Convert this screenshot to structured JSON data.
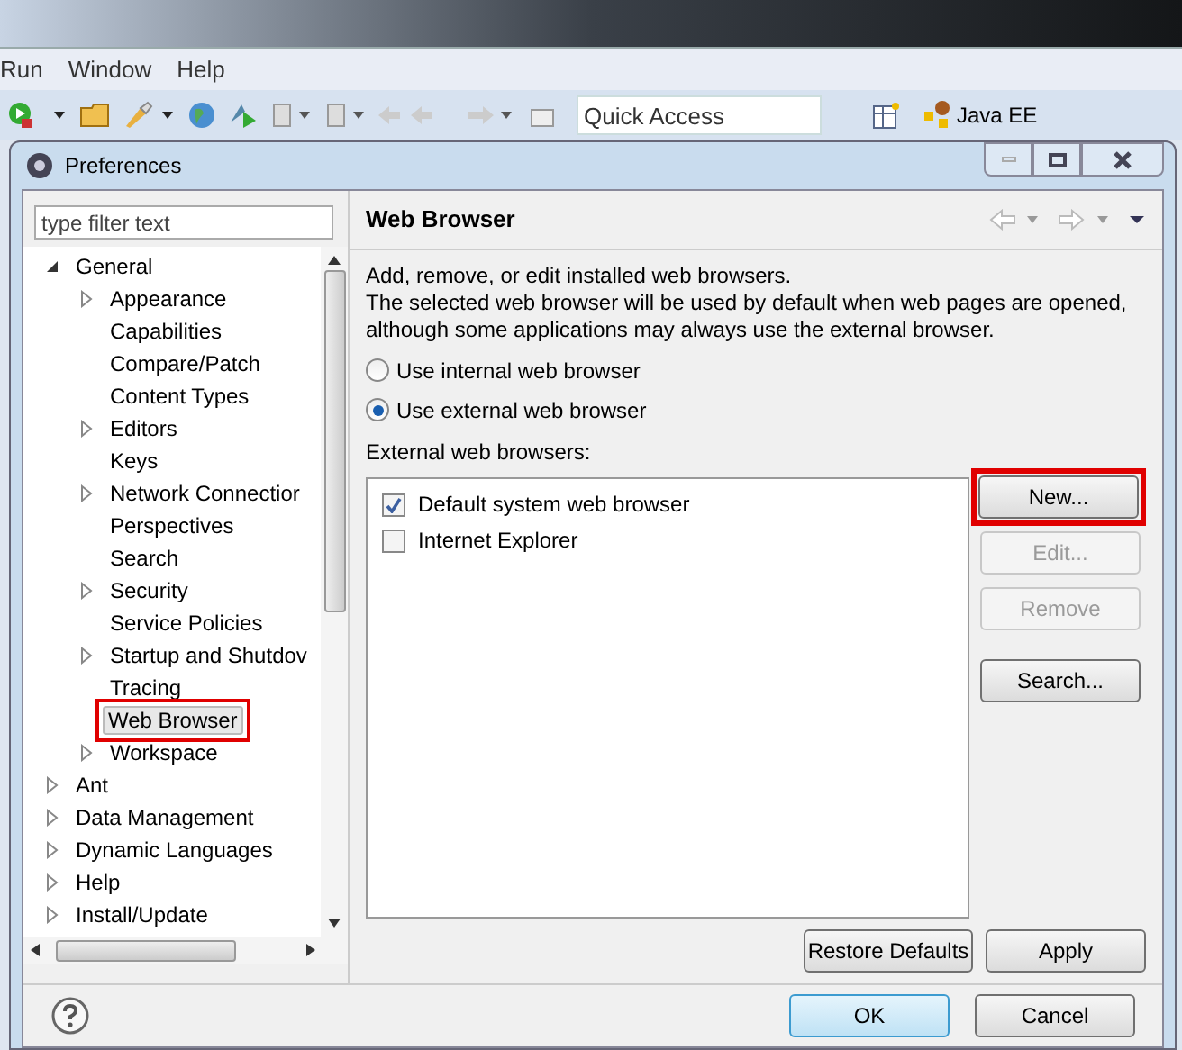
{
  "menu_bar": [
    "Run",
    "Window",
    "Help"
  ],
  "toolbar": {
    "quick_access": {
      "placeholder": "Quick Access"
    },
    "perspective": "Java EE"
  },
  "dialog": {
    "title": "Preferences",
    "filter": {
      "placeholder": "type filter text"
    },
    "tree": [
      {
        "label": "General",
        "kind": "branch",
        "expanded": true,
        "selected": false,
        "highlighted": false,
        "children": [
          {
            "label": "Appearance",
            "kind": "branch",
            "expanded": false,
            "selected": false,
            "highlighted": false
          },
          {
            "label": "Capabilities",
            "kind": "leaf",
            "selected": false,
            "highlighted": false
          },
          {
            "label": "Compare/Patch",
            "kind": "leaf",
            "selected": false,
            "highlighted": false
          },
          {
            "label": "Content Types",
            "kind": "leaf",
            "selected": false,
            "highlighted": false
          },
          {
            "label": "Editors",
            "kind": "branch",
            "expanded": false,
            "selected": false,
            "highlighted": false
          },
          {
            "label": "Keys",
            "kind": "leaf",
            "selected": false,
            "highlighted": false
          },
          {
            "label": "Network Connectior",
            "kind": "branch",
            "expanded": false,
            "selected": false,
            "highlighted": false
          },
          {
            "label": "Perspectives",
            "kind": "leaf",
            "selected": false,
            "highlighted": false
          },
          {
            "label": "Search",
            "kind": "leaf",
            "selected": false,
            "highlighted": false
          },
          {
            "label": "Security",
            "kind": "branch",
            "expanded": false,
            "selected": false,
            "highlighted": false
          },
          {
            "label": "Service Policies",
            "kind": "leaf",
            "selected": false,
            "highlighted": false
          },
          {
            "label": "Startup and Shutdov",
            "kind": "branch",
            "expanded": false,
            "selected": false,
            "highlighted": false
          },
          {
            "label": "Tracing",
            "kind": "leaf",
            "selected": false,
            "highlighted": false
          },
          {
            "label": "Web Browser",
            "kind": "leaf",
            "selected": true,
            "highlighted": true
          },
          {
            "label": "Workspace",
            "kind": "branch",
            "expanded": false,
            "selected": false,
            "highlighted": false
          }
        ]
      },
      {
        "label": "Ant",
        "kind": "branch",
        "expanded": false,
        "selected": false,
        "highlighted": false
      },
      {
        "label": "Data Management",
        "kind": "branch",
        "expanded": false,
        "selected": false,
        "highlighted": false
      },
      {
        "label": "Dynamic Languages",
        "kind": "branch",
        "expanded": false,
        "selected": false,
        "highlighted": false
      },
      {
        "label": "Help",
        "kind": "branch",
        "expanded": false,
        "selected": false,
        "highlighted": false
      },
      {
        "label": "Install/Update",
        "kind": "branch",
        "expanded": false,
        "selected": false,
        "highlighted": false
      }
    ],
    "page": {
      "title": "Web Browser",
      "description": [
        "Add, remove, or edit installed web browsers.",
        "The selected web browser will be used by default when web pages are opened, although some applications may always use the external browser."
      ],
      "radios": [
        {
          "label": "Use internal web browser",
          "selected": false
        },
        {
          "label": "Use external web browser",
          "selected": true
        }
      ],
      "list_label": "External web browsers:",
      "browsers": [
        {
          "label": "Default system web browser",
          "checked": true
        },
        {
          "label": "Internet Explorer",
          "checked": false
        }
      ],
      "side_buttons": [
        {
          "label": "New...",
          "disabled": false,
          "highlighted": true
        },
        {
          "label": "Edit...",
          "disabled": true,
          "highlighted": false
        },
        {
          "label": "Remove",
          "disabled": true,
          "highlighted": false
        },
        {
          "label": "Search...",
          "disabled": false,
          "highlighted": false
        }
      ],
      "footer_buttons": [
        "Restore Defaults",
        "Apply"
      ]
    },
    "buttons": [
      {
        "label": "OK",
        "kind": "default"
      },
      {
        "label": "Cancel",
        "kind": "normal"
      }
    ]
  }
}
